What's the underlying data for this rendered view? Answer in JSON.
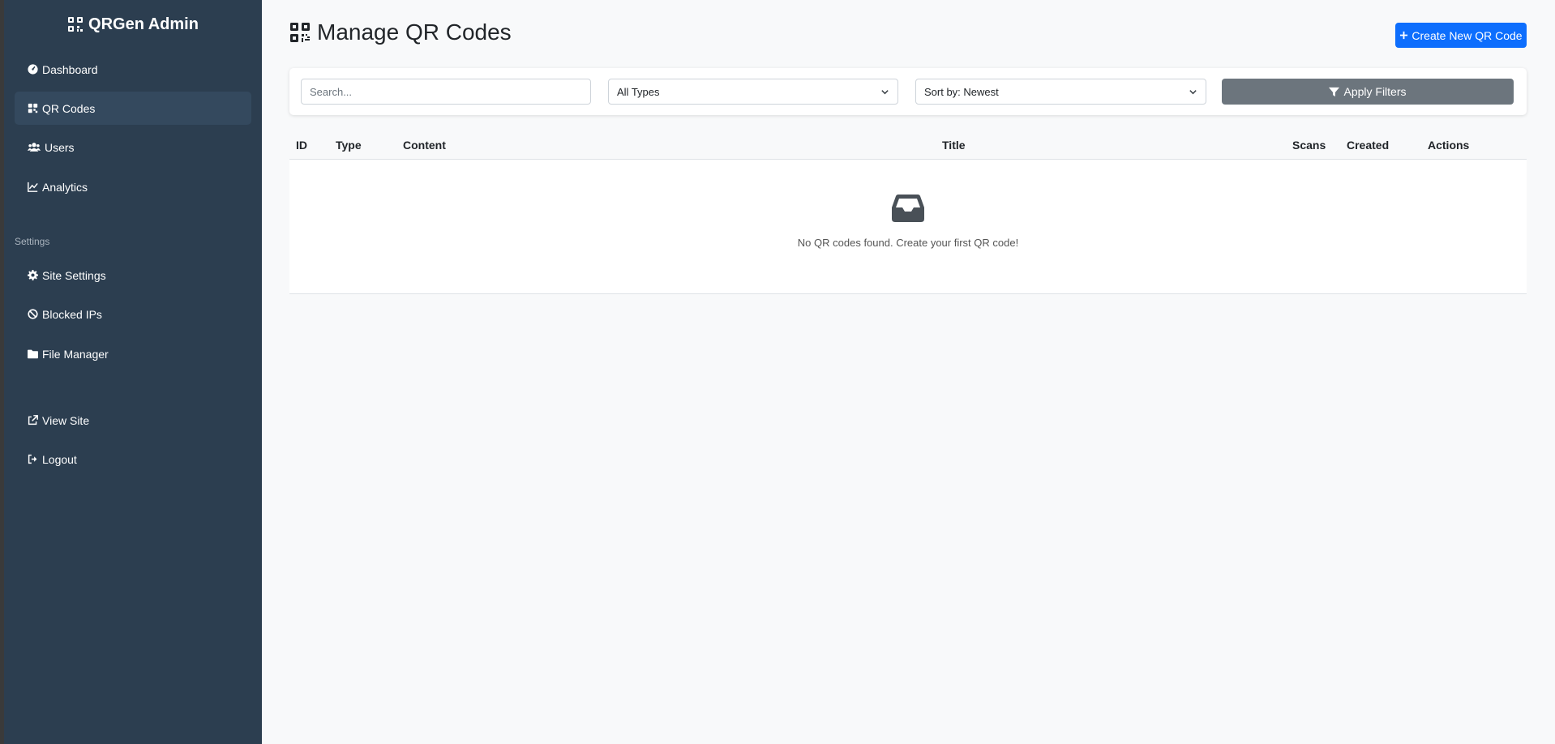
{
  "app": {
    "brand": "QRGen Admin"
  },
  "sidebar": {
    "items": [
      {
        "label": "Dashboard",
        "icon": "dashboard-icon"
      },
      {
        "label": "QR Codes",
        "icon": "qrcode-icon",
        "active": true
      },
      {
        "label": "Users",
        "icon": "users-icon"
      },
      {
        "label": "Analytics",
        "icon": "chart-line-icon"
      }
    ],
    "settings_heading": "Settings",
    "settings_items": [
      {
        "label": "Site Settings",
        "icon": "gear-icon"
      },
      {
        "label": "Blocked IPs",
        "icon": "ban-icon"
      },
      {
        "label": "File Manager",
        "icon": "folder-icon"
      }
    ],
    "footer_items": [
      {
        "label": "View Site",
        "icon": "external-link-icon"
      },
      {
        "label": "Logout",
        "icon": "sign-out-icon"
      }
    ]
  },
  "header": {
    "title": "Manage QR Codes",
    "create_button": "Create New QR Code"
  },
  "filters": {
    "search_placeholder": "Search...",
    "type_select": "All Types",
    "sort_select": "Sort by: Newest",
    "apply_button": "Apply Filters"
  },
  "table": {
    "columns": [
      "ID",
      "Type",
      "Content",
      "Title",
      "Scans",
      "Created",
      "Actions"
    ],
    "empty_message": "No QR codes found. Create your first QR code!"
  },
  "colors": {
    "sidebar_bg": "#2c3e50",
    "primary": "#0d6efd",
    "secondary": "#6c757d"
  }
}
